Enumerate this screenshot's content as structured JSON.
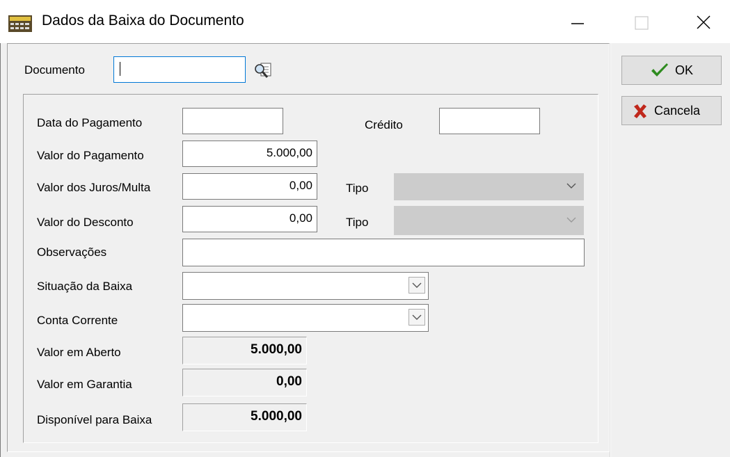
{
  "window": {
    "title": "Dados da Baixa do Documento",
    "icon": "calculator-icon",
    "controls": [
      "minimize-icon",
      "maximize-icon",
      "close-icon"
    ]
  },
  "documento": {
    "label": "Documento",
    "value": "",
    "search_icon": "search-document-icon"
  },
  "form": {
    "data_pagamento": {
      "label": "Data do Pagamento",
      "value": ""
    },
    "credito": {
      "label": "Crédito",
      "value": ""
    },
    "valor_pagamento": {
      "label": "Valor do Pagamento",
      "value": "5.000,00"
    },
    "valor_juros": {
      "label": "Valor dos Juros/Multa",
      "value": "0,00",
      "tipo_label": "Tipo",
      "tipo_value": ""
    },
    "valor_desconto": {
      "label": "Valor do Desconto",
      "value": "0,00",
      "tipo_label": "Tipo",
      "tipo_value": ""
    },
    "observacoes": {
      "label": "Observações",
      "value": ""
    },
    "situacao_baixa": {
      "label": "Situação da Baixa",
      "value": ""
    },
    "conta_corrente": {
      "label": "Conta Corrente",
      "value": ""
    },
    "valor_aberto": {
      "label": "Valor em Aberto",
      "value": "5.000,00"
    },
    "valor_garantia": {
      "label": "Valor em Garantia",
      "value": "0,00"
    },
    "disponivel": {
      "label": "Disponível para Baixa",
      "value": "5.000,00"
    }
  },
  "buttons": {
    "ok": {
      "label": "OK",
      "icon": "checkmark-icon",
      "color": "#2e8b1f"
    },
    "cancel": {
      "label": "Cancela",
      "icon": "x-icon",
      "color": "#c0281c"
    }
  }
}
